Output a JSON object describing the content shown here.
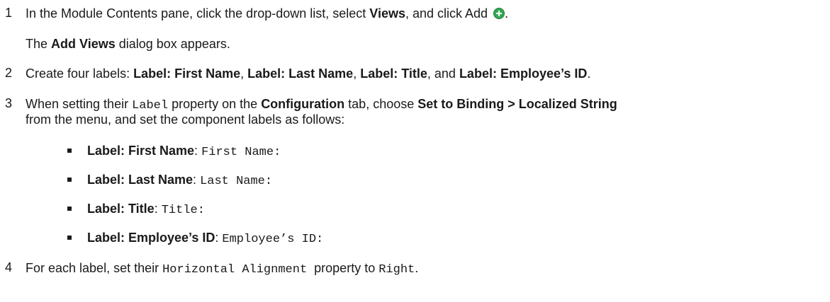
{
  "steps": [
    {
      "number": "1",
      "text_before": "In the Module Contents pane, click the drop-down list, select ",
      "bold_views": "Views",
      "text_after": ", and click Add",
      "period": ".",
      "icon": "add-icon"
    },
    {
      "note_the": "The ",
      "note_bold": "Add Views",
      "note_after": " dialog box appears."
    },
    {
      "number": "2",
      "text_before": "Create four labels: ",
      "label_first": "Label: First Name",
      "comma1": ", ",
      "label_last": "Label: Last Name",
      "comma2": ", ",
      "label_title": "Label: Title",
      "and": ", and ",
      "label_emp": "Label: Employee’s ID",
      "period": "."
    },
    {
      "number": "3",
      "text_before": "When setting their ",
      "mono_label": "Label",
      "text_mid1": " property on the ",
      "bold_config": "Configuration",
      "text_mid2": " tab, choose ",
      "bold_binding": "Set to Binding > Localized String",
      "line2": "from the menu, and set the component labels as follows:"
    },
    {
      "number": "4",
      "text_before": "For each label, set their ",
      "mono_prop": "Horizontal Alignment",
      "text_mid": "  property to ",
      "mono_value": "Right",
      "period": "."
    }
  ],
  "bullets": [
    {
      "bold": "Label: First Name",
      "sep": ": ",
      "value": "First Name:"
    },
    {
      "bold": "Label: Last Name",
      "sep": ": ",
      "value": "Last Name:"
    },
    {
      "bold": "Label: Title",
      "sep": ": ",
      "value": "Title:"
    },
    {
      "bold": "Label: Employee’s ID",
      "sep": ": ",
      "value": "Employee’s ID:"
    }
  ]
}
